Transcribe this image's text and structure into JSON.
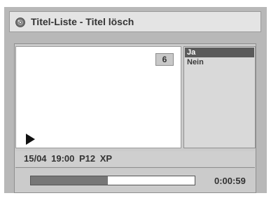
{
  "header": {
    "title": "Titel-Liste - Titel lösch",
    "icon": "disc-icon"
  },
  "preview": {
    "title_number": "6",
    "play_icon": "play-icon"
  },
  "menu": {
    "items": [
      {
        "label": "Ja",
        "selected": true
      },
      {
        "label": "Nein",
        "selected": false
      }
    ]
  },
  "info": {
    "text": "15/04 19:00 P12 XP"
  },
  "progress": {
    "fraction": 0.47,
    "time": "0:00:59"
  },
  "colors": {
    "frame": "#b8b8b8",
    "selection": "#5a5a5a",
    "progress_fill": "#777777"
  }
}
